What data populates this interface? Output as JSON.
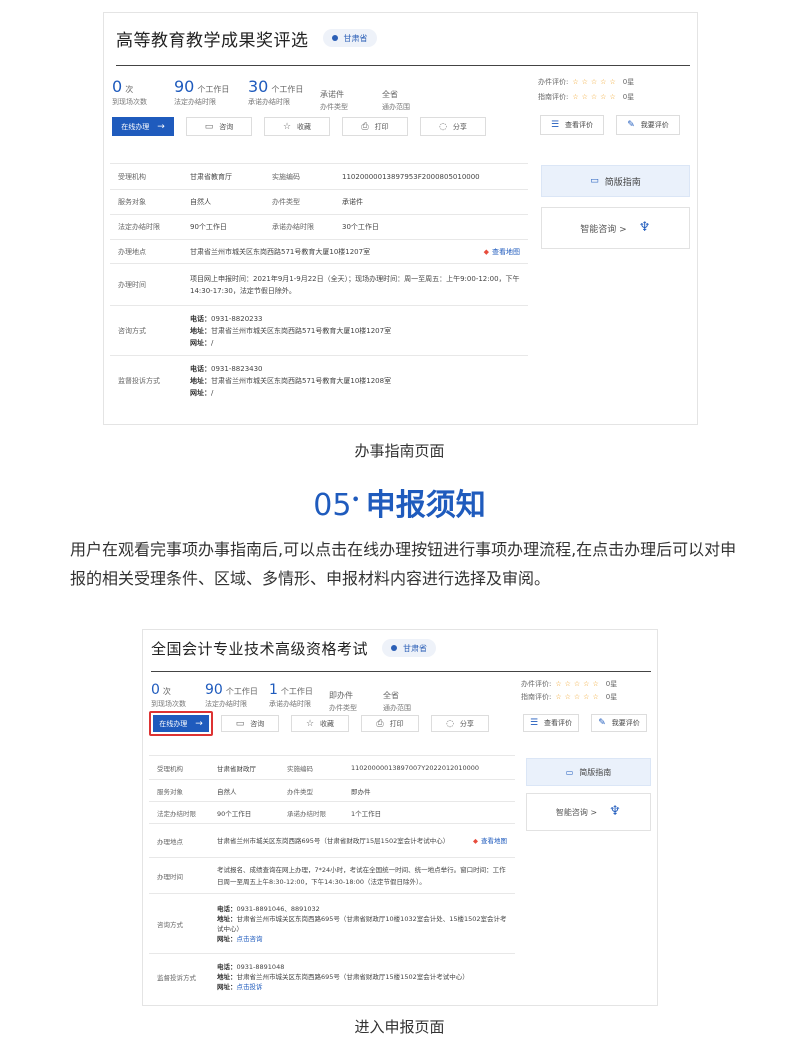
{
  "screen1": {
    "title": "高等教育教学成果奖评选",
    "location": "甘肃省",
    "stats": [
      {
        "num": "0",
        "unit": "次",
        "caption": "到现场次数"
      },
      {
        "num": "90",
        "unit": "个工作日",
        "caption": "法定办结时限"
      },
      {
        "num": "30",
        "unit": "个工作日",
        "caption": "承诺办结时限"
      },
      {
        "num": "",
        "unit": "承诺件",
        "caption": "办件类型"
      },
      {
        "num": "",
        "unit": "全省",
        "caption": "通办范围"
      }
    ],
    "eval": {
      "label1": "办件评价:",
      "label2": "指南评价:",
      "stars": "☆☆☆☆☆",
      "score": "0星"
    },
    "buttons": {
      "online": "在线办理",
      "consult": "咨询",
      "collect": "收藏",
      "print": "打印",
      "share": "分享"
    },
    "right_buttons": {
      "view_eval": "查看评价",
      "my_eval": "我要评价"
    },
    "side": {
      "guide": "简版指南",
      "smart": "智能咨询 >"
    },
    "rows": [
      {
        "l1": "受理机构",
        "v1": "甘肃省教育厅",
        "l2": "实施编码",
        "v2": "11020000013897953F2000805010000"
      },
      {
        "l1": "服务对象",
        "v1": "自然人",
        "l2": "办件类型",
        "v2": "承诺件"
      },
      {
        "l1": "法定办结时限",
        "v1": "90个工作日",
        "l2": "承诺办结时限",
        "v2": "30个工作日"
      }
    ],
    "address": {
      "label": "办理地点",
      "value": "甘肃省兰州市城关区东岗西路571号教育大厦10楼1207室",
      "map": "查看地图"
    },
    "time": {
      "label": "办理时间",
      "value": "项目网上申报时间：2021年9月1-9月22日（全天）；现场办理时间：周一至周五：上午9:00-12:00，下午14:30-17:30，法定节假日除外。"
    },
    "consult": {
      "label": "咨询方式",
      "phone_k": "电话：",
      "phone": "0931-8820233",
      "addr_k": "地址：",
      "addr": "甘肃省兰州市城关区东岗西路571号教育大厦10楼1207室",
      "web_k": "网址：",
      "web": "/"
    },
    "complaint": {
      "label": "监督投诉方式",
      "phone_k": "电话：",
      "phone": "0931-8823430",
      "addr_k": "地址：",
      "addr": "甘肃省兰州市城关区东岗西路571号教育大厦10楼1208室",
      "web_k": "网址：",
      "web": "/"
    }
  },
  "caption1": "办事指南页面",
  "section": {
    "num": "05",
    "title": "申报须知"
  },
  "paragraph": "用户在观看完事项办事指南后,可以点击在线办理按钮进行事项办理流程,在点击办理后可以对申报的相关受理条件、区域、多情形、申报材料内容进行选择及审阅。",
  "screen2": {
    "title": "全国会计专业技术高级资格考试",
    "location": "甘肃省",
    "stats": [
      {
        "num": "0",
        "unit": "次",
        "caption": "到现场次数"
      },
      {
        "num": "90",
        "unit": "个工作日",
        "caption": "法定办结时限"
      },
      {
        "num": "1",
        "unit": "个工作日",
        "caption": "承诺办结时限"
      },
      {
        "num": "",
        "unit": "即办件",
        "caption": "办件类型"
      },
      {
        "num": "",
        "unit": "全省",
        "caption": "通办范围"
      }
    ],
    "eval": {
      "label1": "办件评价:",
      "label2": "指南评价:",
      "stars": "☆☆☆☆☆",
      "score": "0星"
    },
    "buttons": {
      "online": "在线办理",
      "consult": "咨询",
      "collect": "收藏",
      "print": "打印",
      "share": "分享"
    },
    "right_buttons": {
      "view_eval": "查看评价",
      "my_eval": "我要评价"
    },
    "side": {
      "guide": "简版指南",
      "smart": "智能咨询 >"
    },
    "rows": [
      {
        "l1": "受理机构",
        "v1": "甘肃省财政厅",
        "l2": "实施编码",
        "v2": "11020000013897007Y2022012010000"
      },
      {
        "l1": "服务对象",
        "v1": "自然人",
        "l2": "办件类型",
        "v2": "即办件"
      },
      {
        "l1": "法定办结时限",
        "v1": "90个工作日",
        "l2": "承诺办结时限",
        "v2": "1个工作日"
      }
    ],
    "address": {
      "label": "办理地点",
      "value": "甘肃省兰州市城关区东岗西路695号（甘肃省财政厅15层1502室会计考试中心）",
      "map": "查看地图"
    },
    "time": {
      "label": "办理时间",
      "value": "考试报名、成绩查询在网上办理，7*24小时，考试在全国统一时间、统一地点举行。窗口时间：工作日周一至周五上午8:30-12:00，下午14:30-18:00（法定节假日除外）。"
    },
    "consult": {
      "label": "咨询方式",
      "phone_k": "电话：",
      "phone": "0931-8891046、8891032",
      "addr_k": "地址：",
      "addr": "甘肃省兰州市城关区东岗西路695号（甘肃省财政厅10楼1032室会计处、15楼1502室会计考试中心）",
      "web_k": "网址：",
      "web": "点击咨询"
    },
    "complaint": {
      "label": "监督投诉方式",
      "phone_k": "电话：",
      "phone": "0931-8891048",
      "addr_k": "地址：",
      "addr": "甘肃省兰州市城关区东岗西路695号（甘肃省财政厅15楼1502室会计考试中心）",
      "web_k": "网址：",
      "web": "点击投诉"
    }
  },
  "caption2": "进入申报页面"
}
